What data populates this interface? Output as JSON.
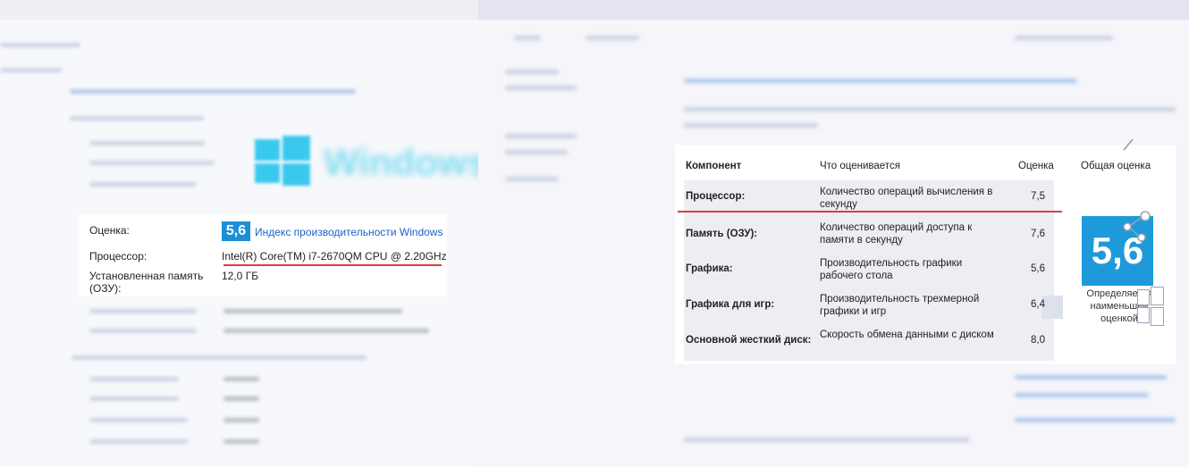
{
  "system_info": {
    "rating_label": "Оценка:",
    "rating_score": "5,6",
    "rating_link": "Индекс производительности Windows",
    "processor_label": "Процессор:",
    "processor_value": "Intel(R) Core(TM) i7-2670QM CPU @ 2.20GHz",
    "memory_label": "Установленная память (ОЗУ):",
    "memory_value": "12,0 ГБ"
  },
  "assessment_table": {
    "headers": {
      "component": "Компонент",
      "what": "Что оценивается",
      "score": "Оценка",
      "total": "Общая оценка"
    },
    "rows": [
      {
        "name": "Процессор:",
        "desc": "Количество операций вычисления в секунду",
        "score": "7,5"
      },
      {
        "name": "Память (ОЗУ):",
        "desc": "Количество операций доступа к памяти в секунду",
        "score": "7,6"
      },
      {
        "name": "Графика:",
        "desc": "Производительность графики рабочего стола",
        "score": "5,6"
      },
      {
        "name": "Графика для игр:",
        "desc": "Производительность трехмерной графики и игр",
        "score": "6,4"
      },
      {
        "name": "Основной жесткий диск:",
        "desc": "Скорость обмена данными с диском",
        "score": "8,0"
      }
    ],
    "total_score": "5,6",
    "total_caption": "Определяется наименьшей оценкой"
  },
  "colors": {
    "accent": "#1e9adb",
    "link": "#1a63c4",
    "underline": "#e23a3a"
  },
  "icons": [
    "windows-logo-icon",
    "share-icon",
    "windows-logo-small-icon",
    "pencil-icon"
  ]
}
